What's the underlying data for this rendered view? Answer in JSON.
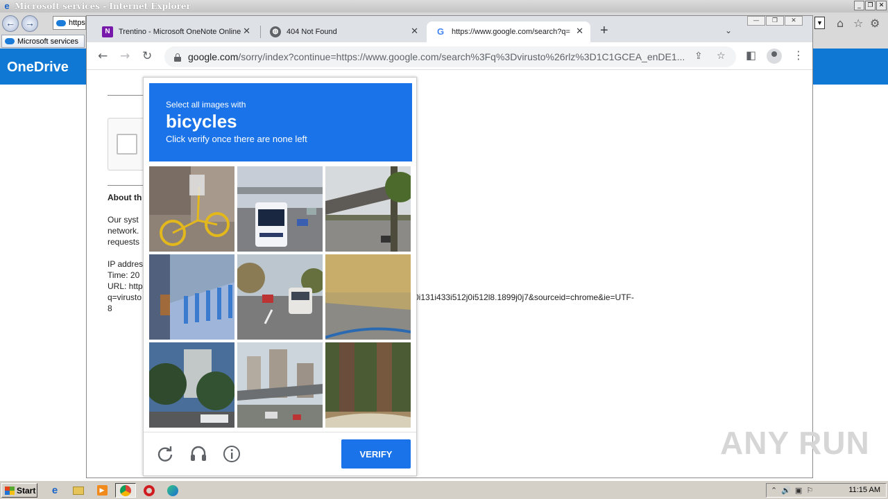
{
  "ie": {
    "title": "Microsoft services - Internet Explorer",
    "address_text": "https",
    "tab_label": "Microsoft services",
    "onedrive_title": "OneDrive"
  },
  "chrome": {
    "tabs": [
      {
        "label": "Trentino - Microsoft OneNote Online",
        "icon": "onenote-icon"
      },
      {
        "label": "404 Not Found",
        "icon": "globe-icon"
      },
      {
        "label": "https://www.google.com/search?q=",
        "icon": "google-icon",
        "active": true
      }
    ],
    "url_host": "google.com",
    "url_rest": "/sorry/index?continue=https://www.google.com/search%3Fq%3Dvirusto%26rlz%3D1C1GCEA_enDE1..."
  },
  "page": {
    "heading": "About th",
    "para": [
      "Our syst",
      "network.",
      "requests"
    ],
    "ip_lines": [
      "IP addres",
      "Time: 20",
      "URL: http",
      "q=virusto"
    ],
    "url_tail": "0i131i433i512j0i512l8.1899j0j7&sourceid=chrome&ie=UTF-",
    "url_tail2": "8"
  },
  "captcha": {
    "instruction": "Select all images with",
    "target": "bicycles",
    "subtext": "Click verify once there are none left",
    "verify_label": "VERIFY",
    "tiles": [
      "bicycle on sidewalk",
      "city bus",
      "covered platform",
      "bike share rack",
      "street with van",
      "grass field",
      "trees and building",
      "highway city",
      "tree trunks"
    ]
  },
  "watermark": "ANY RUN",
  "taskbar": {
    "start_label": "Start",
    "clock": "11:15 AM"
  },
  "colors": {
    "captcha_blue": "#1a73e8",
    "onedrive_blue": "#0f78d4"
  }
}
